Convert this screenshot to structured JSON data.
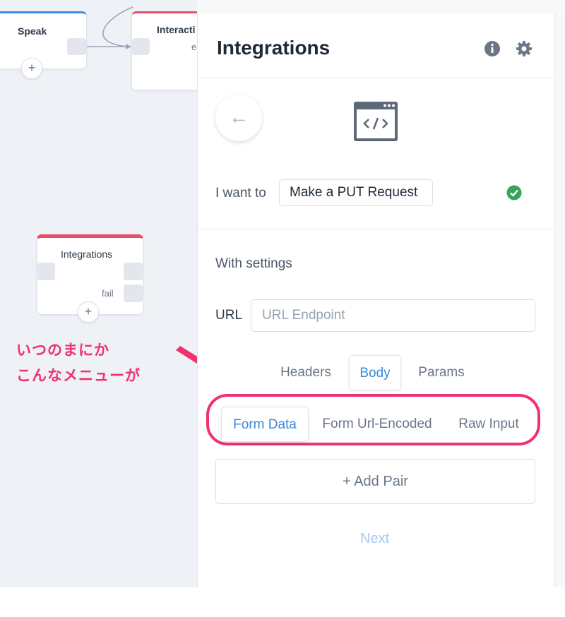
{
  "canvas": {
    "nodes": [
      {
        "title": "Speak"
      },
      {
        "title": "Interacti",
        "port_label": "e"
      },
      {
        "title": "Integrations",
        "port_label": "fail"
      }
    ],
    "plus_label": "+"
  },
  "annotation": {
    "line1": "いつのまにか",
    "line2": "こんなメニューが",
    "color": "#f0316e"
  },
  "panel": {
    "title": "Integrations",
    "icons": {
      "info": "info-icon",
      "settings": "gear-icon",
      "back": "arrow-left-icon",
      "code": "code-window-icon",
      "status": "check-circle-icon"
    },
    "back_glyph": "←",
    "i_want_label": "I want to",
    "action_value": "Make a PUT Request",
    "with_settings_label": "With settings",
    "url_label": "URL",
    "url_placeholder": "URL Endpoint",
    "tabs": [
      "Headers",
      "Body",
      "Params"
    ],
    "active_tab": "Body",
    "body_tabs": [
      "Form Data",
      "Form Url-Encoded",
      "Raw Input"
    ],
    "active_body_tab": "Form Data",
    "add_pair_label": "+  Add Pair",
    "next_label": "Next",
    "accent_color": "#3b89d8",
    "success_color": "#3aa35a"
  }
}
